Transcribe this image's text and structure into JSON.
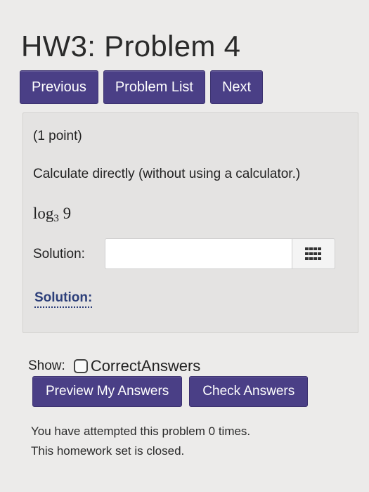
{
  "header": {
    "title": "HW3: Problem 4"
  },
  "nav": {
    "previous_label": "Previous",
    "problem_list_label": "Problem List",
    "next_label": "Next"
  },
  "problem": {
    "points": "(1 point)",
    "statement": "Calculate directly (without using a calculator.)",
    "math": {
      "function": "log",
      "base": "3",
      "argument": "9"
    },
    "answer_label": "Solution:",
    "answer_value": "",
    "palette_icon": "grid-icon",
    "solution_link": "Solution:"
  },
  "show": {
    "label": "Show:",
    "option": "CorrectAnswers",
    "checked": false
  },
  "actions": {
    "preview_label": "Preview My Answers",
    "check_label": "Check Answers"
  },
  "messages": {
    "attempts": "You have attempted this problem 0 times.",
    "status": "This homework set is closed."
  },
  "colors": {
    "button": "#4a3f86",
    "link": "#2c3f7a",
    "background": "#ecebea",
    "panel": "#e4e3e2"
  }
}
